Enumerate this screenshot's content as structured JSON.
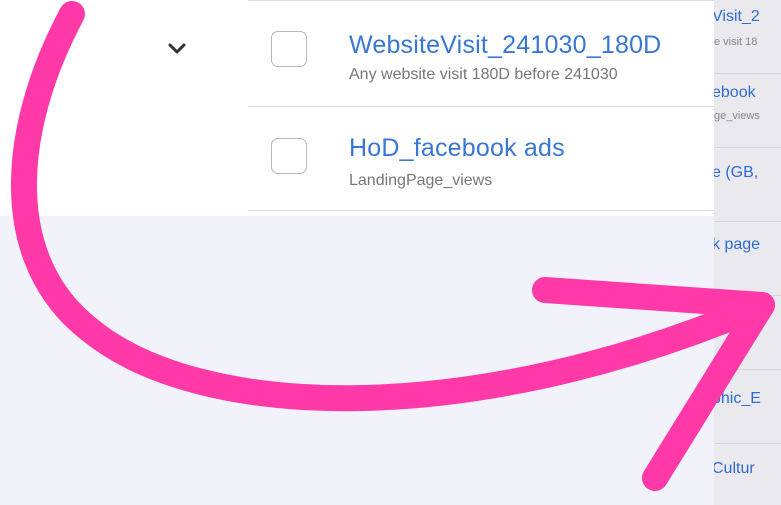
{
  "rows": [
    {
      "title": "WebsiteVisit_241030_180D",
      "subtitle": "Any website visit 180D before 241030"
    },
    {
      "title": "HoD_facebook ads",
      "subtitle": "LandingPage_views"
    }
  ],
  "side_panel": {
    "items": [
      {
        "title": "Visit_2",
        "subtitle": "e visit 18"
      },
      {
        "title": "ebook",
        "subtitle": "ge_views"
      },
      {
        "title": "e (GB,",
        "subtitle": ""
      },
      {
        "title": "k page",
        "subtitle": ""
      },
      {
        "title": "",
        "subtitle": ""
      },
      {
        "title": "phic_E",
        "subtitle": ""
      },
      {
        "title": "Cultur",
        "subtitle": ""
      }
    ]
  },
  "colors": {
    "link": "#3877d6",
    "arrow": "#ff3aa8",
    "band": "#f1f2fa"
  },
  "icons": [
    "chevron-down-icon",
    "curved-arrow-annotation"
  ]
}
